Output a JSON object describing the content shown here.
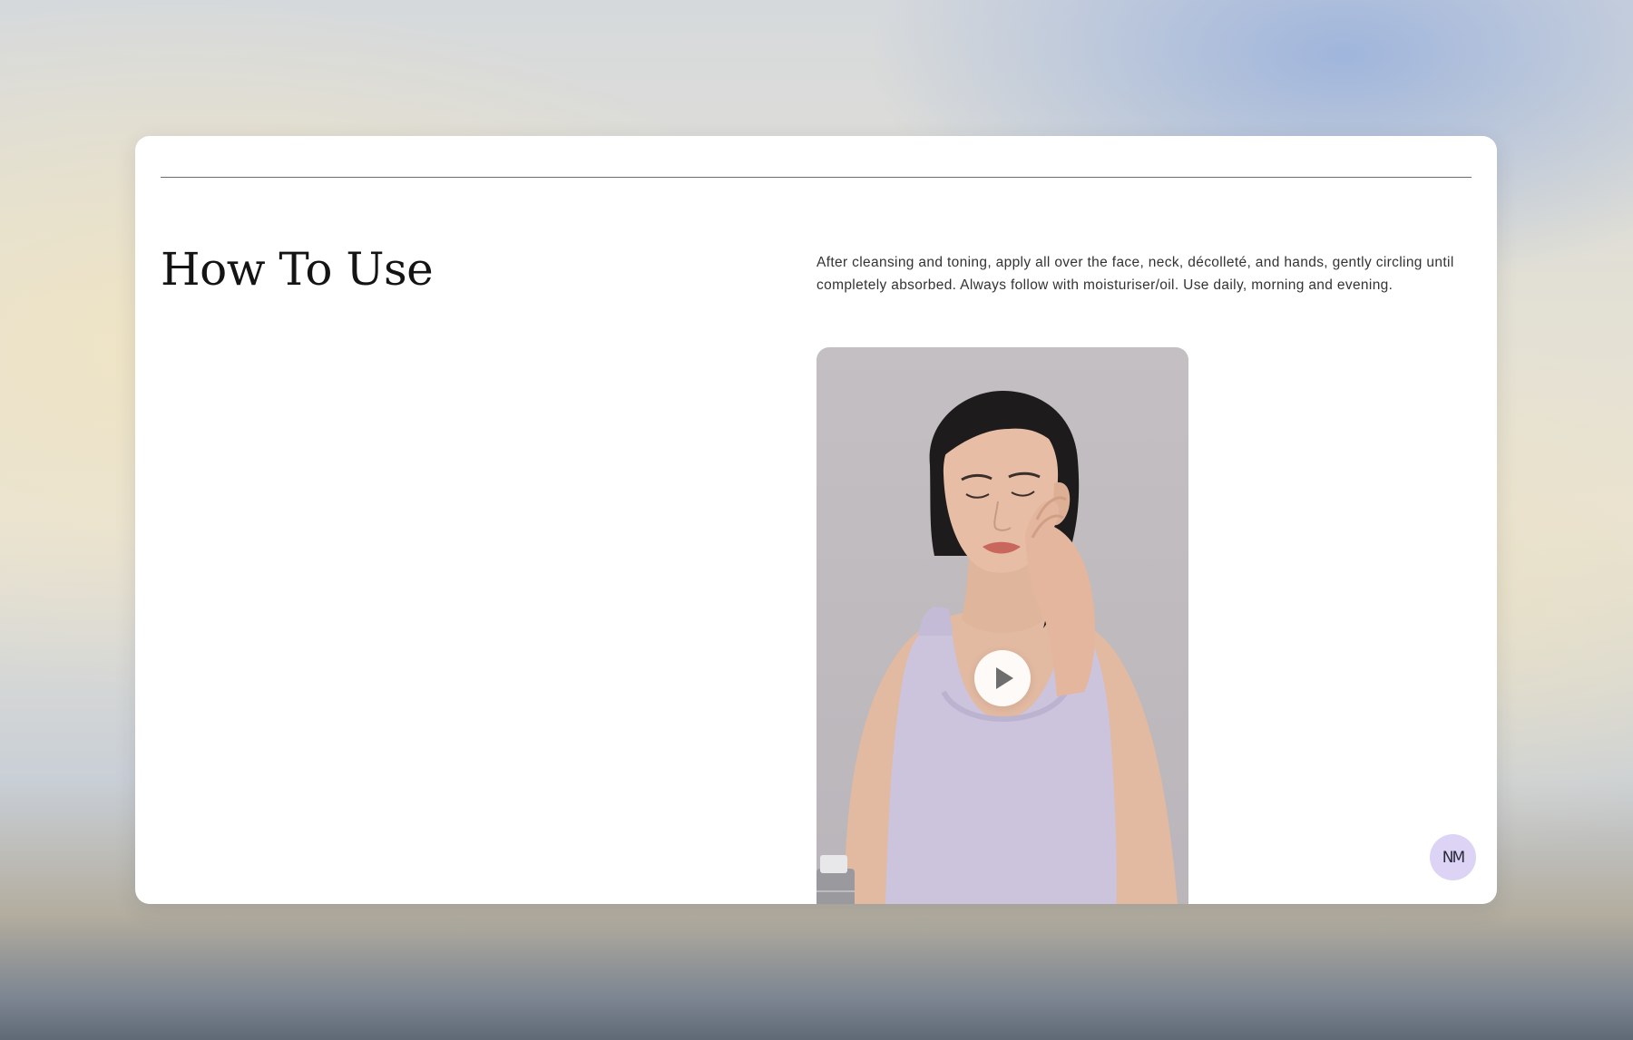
{
  "section": {
    "title": "How To Use",
    "instructions": "After cleansing and toning, apply all over the face, neck, décolleté, and hands, gently circling until completely absorbed. Always follow with moisturiser/oil. Use daily, morning and evening."
  },
  "video": {
    "play_icon": "play-icon"
  },
  "badge": {
    "label": "NM"
  },
  "colors": {
    "card": "#ffffff",
    "text": "#141414",
    "badge": "#dcd3f5",
    "top_wash": "#a6b9d8",
    "warm_wash": "#ede3cc"
  }
}
